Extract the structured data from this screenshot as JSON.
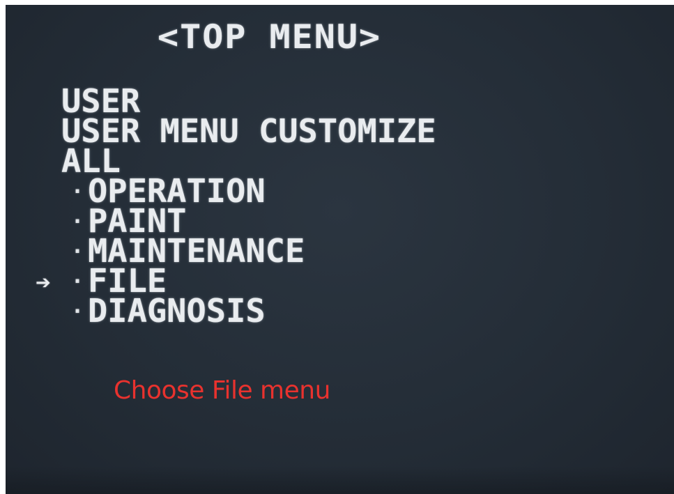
{
  "screen": {
    "title": "<TOP MENU>",
    "top_items": [
      {
        "label": "USER"
      },
      {
        "label": "USER MENU CUSTOMIZE"
      },
      {
        "label": "ALL"
      }
    ],
    "sub_items": [
      {
        "label": "OPERATION"
      },
      {
        "label": "PAINT"
      },
      {
        "label": "MAINTENANCE"
      },
      {
        "label": "FILE"
      },
      {
        "label": "DIAGNOSIS"
      }
    ],
    "bullet_glyph": "·",
    "cursor_glyph": "➔",
    "selected_item": "FILE"
  },
  "annotation": {
    "caption": "Choose File menu",
    "color": "#e8322e"
  },
  "colors": {
    "screen_background": "#242d37",
    "text": "#e9ecef"
  }
}
